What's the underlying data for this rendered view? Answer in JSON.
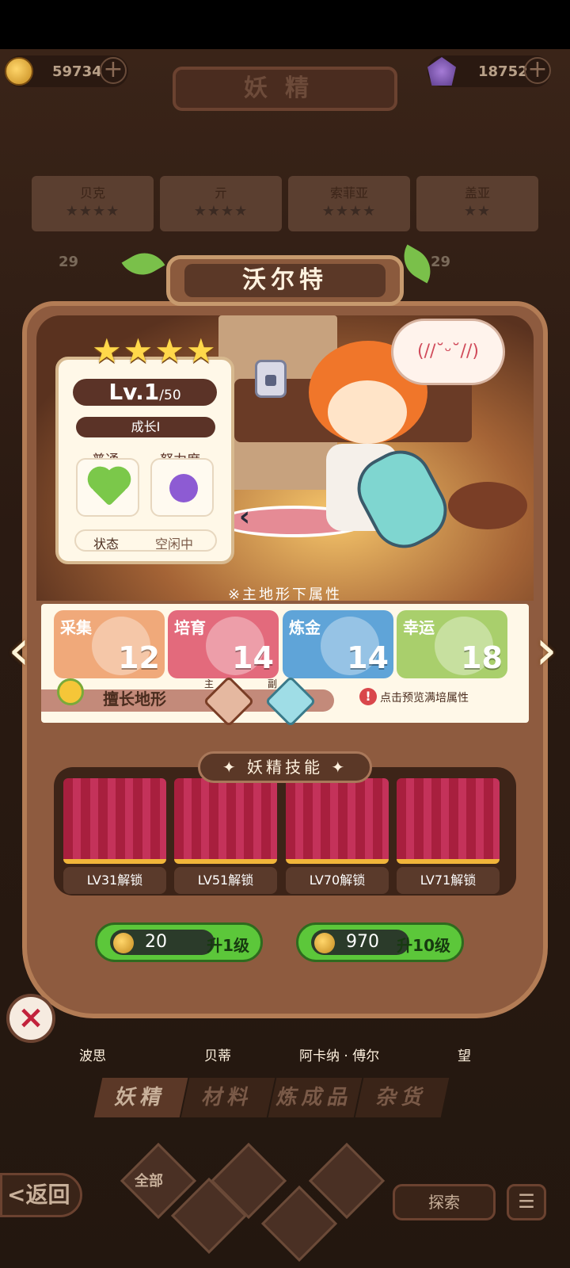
{
  "currency": {
    "gold": "59734",
    "gems": "18752"
  },
  "page_title": "妖精",
  "background_list": {
    "row1": [
      {
        "name": "贝克",
        "stars": "★★★★"
      },
      {
        "name": "亓",
        "stars": "★★★★"
      },
      {
        "name": "索菲亚",
        "stars": "★★★★"
      },
      {
        "name": "盖亚",
        "stars": "★★"
      }
    ],
    "levels": [
      "29",
      "29"
    ],
    "bottom_names": [
      "波思",
      "贝蒂",
      "阿卡纳 · 傅尔",
      "望"
    ]
  },
  "fairy": {
    "name": "沃尔特",
    "stars": "★★★★",
    "level": "Lv.1",
    "max_level": "/50",
    "growth": "成长I",
    "attr1_label": "普通",
    "attr2_label": "努力度",
    "state_label": "状态",
    "state_value": "空闲中",
    "emote": "(//˘ᵕ˘//)"
  },
  "attributes": {
    "title": "※主地形下属性",
    "stats": [
      {
        "label": "采集",
        "value": "12",
        "color": "#f0a97a"
      },
      {
        "label": "培育",
        "value": "14",
        "color": "#e36a7c"
      },
      {
        "label": "炼金",
        "value": "14",
        "color": "#5fa4d8"
      },
      {
        "label": "幸运",
        "value": "18",
        "color": "#a9cf6c"
      }
    ],
    "terrain_label": "擅长地形",
    "main_tag": "主",
    "sub_tag": "副",
    "hint": "点击预览满培属性"
  },
  "skills": {
    "title": "妖精技能",
    "slots": [
      "LV31解锁",
      "LV51解锁",
      "LV70解锁",
      "LV71解锁"
    ]
  },
  "upgrade": {
    "btn1_cost": "20",
    "btn1_label": "升1级",
    "btn2_cost": "970",
    "btn2_label": "升10级"
  },
  "tabs": [
    "妖精",
    "材料",
    "炼成品",
    "杂货"
  ],
  "bottom_bar": {
    "back": "<返回",
    "filter_all": "全部",
    "explore": "探索"
  }
}
